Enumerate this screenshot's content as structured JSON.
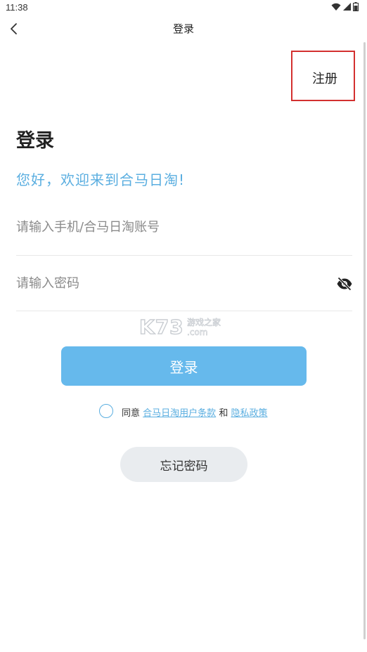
{
  "status_bar": {
    "time": "11:38"
  },
  "nav": {
    "title": "登录"
  },
  "register": {
    "label": "注册"
  },
  "heading": "登录",
  "welcome": "您好，欢迎来到合马日淘!",
  "phone": {
    "placeholder": "请输入手机/合马日淘账号",
    "value": ""
  },
  "password": {
    "placeholder": "请输入密码",
    "value": ""
  },
  "watermark": {
    "text": "K73",
    "sub": "游戏之家",
    "domain": ".com"
  },
  "login_button": "登录",
  "agreement": {
    "prefix": "同意",
    "terms_link": "合马日淘用户条款",
    "and": "和",
    "privacy_link": "隐私政策"
  },
  "forgot_button": "忘记密码",
  "colors": {
    "accent": "#5aaee0",
    "button": "#66b9ec",
    "highlight_box": "#d3302f"
  }
}
